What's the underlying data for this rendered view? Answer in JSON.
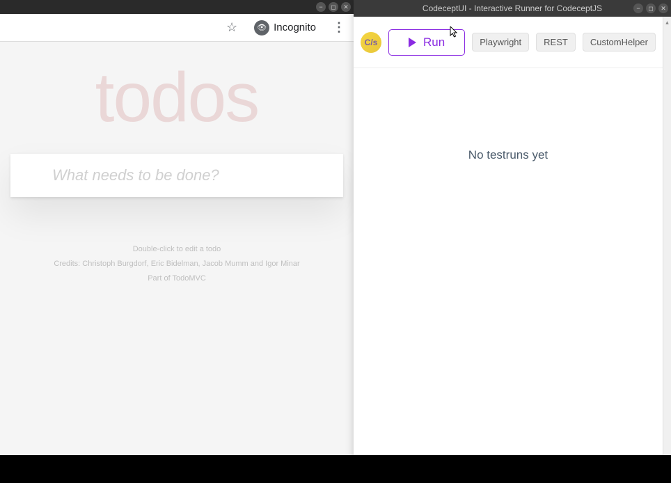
{
  "browser": {
    "incognito_label": "Incognito"
  },
  "todo": {
    "title": "todos",
    "input_placeholder": "What needs to be done?",
    "footer_line1": "Double-click to edit a todo",
    "footer_line2": "Credits: Christoph Burgdorf, Eric Bidelman, Jacob Mumm and Igor Minar",
    "footer_line3": "Part of TodoMVC"
  },
  "codecept": {
    "window_title": "CodeceptUI - Interactive Runner for CodeceptJS",
    "logo_text": "C/s",
    "run_label": "Run",
    "helpers": {
      "playwright": "Playwright",
      "rest": "REST",
      "custom": "CustomHelper"
    },
    "empty_message": "No testruns yet"
  }
}
